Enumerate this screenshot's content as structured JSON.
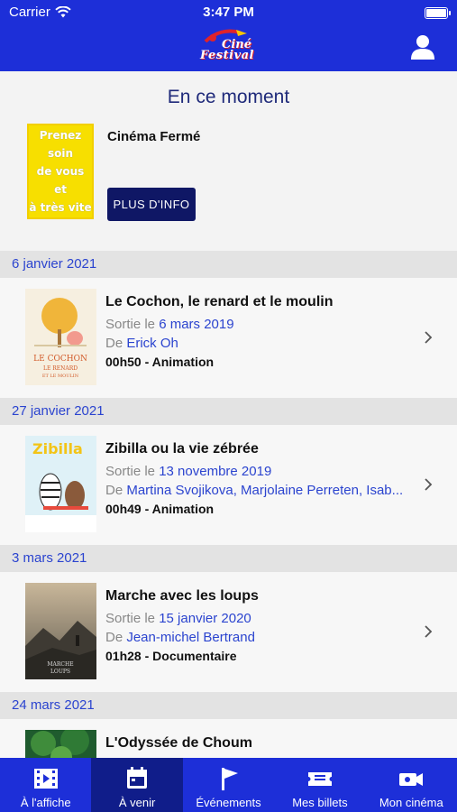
{
  "status_bar": {
    "carrier": "Carrier",
    "time": "3:47 PM"
  },
  "header": {
    "logo_line1": "Ciné",
    "logo_line2": "Festival"
  },
  "main": {
    "section_title": "En ce moment",
    "news": {
      "poster_lines": [
        "Prenez soin",
        "de vous",
        "et",
        "à très vite"
      ],
      "title": "Cinéma Fermé",
      "button_label": "PLUS D'INFO"
    },
    "groups": [
      {
        "date": "6 janvier 2021",
        "movie": {
          "title": "Le Cochon, le renard et le moulin",
          "release_prefix": "Sortie le ",
          "release_date": "6 mars 2019",
          "director_prefix": "De ",
          "director": "Erick Oh",
          "duration": "00h50",
          "genre": "Animation"
        }
      },
      {
        "date": "27 janvier 2021",
        "movie": {
          "title": "Zibilla ou la vie zébrée",
          "release_prefix": "Sortie le ",
          "release_date": "13 novembre 2019",
          "director_prefix": "De ",
          "director": "Martina Svojikova, Marjolaine Perreten, Isab...",
          "duration": "00h49",
          "genre": "Animation"
        }
      },
      {
        "date": "3 mars 2021",
        "movie": {
          "title": "Marche avec les loups",
          "release_prefix": "Sortie le ",
          "release_date": "15 janvier 2020",
          "director_prefix": "De ",
          "director": "Jean-michel Bertrand",
          "duration": "01h28",
          "genre": "Documentaire"
        }
      },
      {
        "date": "24 mars 2021",
        "movie": {
          "title": "L'Odyssée de Choum"
        }
      }
    ]
  },
  "tabbar": {
    "tabs": [
      {
        "label": "À l'affiche",
        "icon": "film-icon"
      },
      {
        "label": "À venir",
        "icon": "calendar-icon",
        "active": true
      },
      {
        "label": "Événements",
        "icon": "flag-icon"
      },
      {
        "label": "Mes billets",
        "icon": "ticket-icon"
      },
      {
        "label": "Mon cinéma",
        "icon": "camera-icon"
      }
    ]
  },
  "colors": {
    "header": "#1d2fd8",
    "active_tab": "#101d8a",
    "link": "#2b44cf",
    "button": "#0f1765"
  }
}
